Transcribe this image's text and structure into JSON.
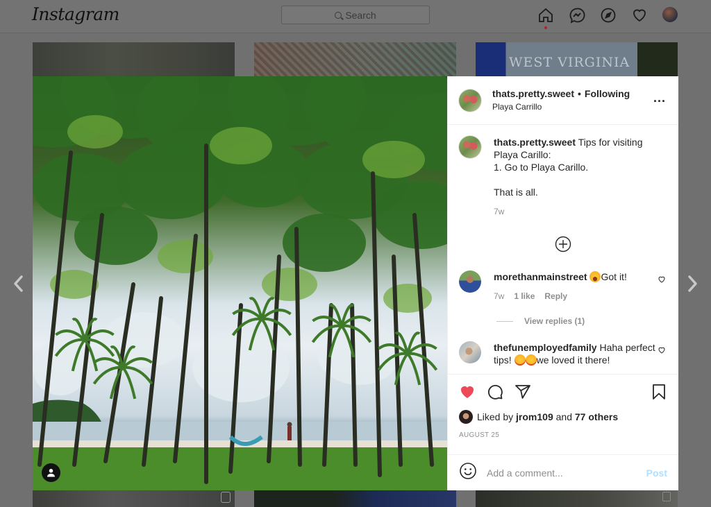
{
  "app": {
    "logo": "Instagram",
    "search_placeholder": "Search",
    "nav": [
      {
        "icon": "home-icon",
        "active": true
      },
      {
        "icon": "messenger-icon"
      },
      {
        "icon": "explore-compass-icon"
      },
      {
        "icon": "activity-heart-icon"
      },
      {
        "icon": "profile-avatar"
      }
    ]
  },
  "background_grid": {
    "top_row": [
      "blurred-gray",
      "mosaic-wall",
      "West Virginia sign"
    ],
    "west_virginia_text": "WEST VIRGINIA",
    "bottom_row_badges": [
      "reel-icon",
      "none",
      "carousel-icon"
    ]
  },
  "modal": {
    "photo": {
      "description": "Palm trees on a beach with a hammock and ocean",
      "tag_icon": "user-tag-icon"
    },
    "header": {
      "username": "thats.pretty.sweet",
      "separator": "•",
      "follow_status": "Following",
      "location": "Playa Carrillo",
      "more_label": "..."
    },
    "caption": {
      "username": "thats.pretty.sweet",
      "text": "Tips for visiting Playa Carillo:\n1. Go to Playa Carillo.\n\nThat is all.",
      "age": "7w"
    },
    "load_more_icon": "plus-circle-icon",
    "comments": [
      {
        "username": "morethanmainstreet",
        "emoji": "😂",
        "text": "Got it!",
        "age": "7w",
        "likes": "1 like",
        "reply_label": "Reply",
        "view_replies": "View replies (1)"
      },
      {
        "username": "thefunemployedfamily",
        "text_before": "Haha perfect tips!",
        "emoji": "😍😍",
        "text_after": "we loved it there!"
      }
    ],
    "actions": {
      "liked": true,
      "like_color": "#ed4956",
      "liked_by_prefix": "Liked by",
      "liked_by_user": "jrom109",
      "liked_by_and": "and",
      "liked_by_others": "77 others",
      "date": "August 25"
    },
    "add_comment": {
      "placeholder": "Add a comment...",
      "value": "",
      "post_label": "Post"
    }
  },
  "navigation": {
    "prev_icon": "chevron-left-icon",
    "next_icon": "chevron-right-icon"
  }
}
